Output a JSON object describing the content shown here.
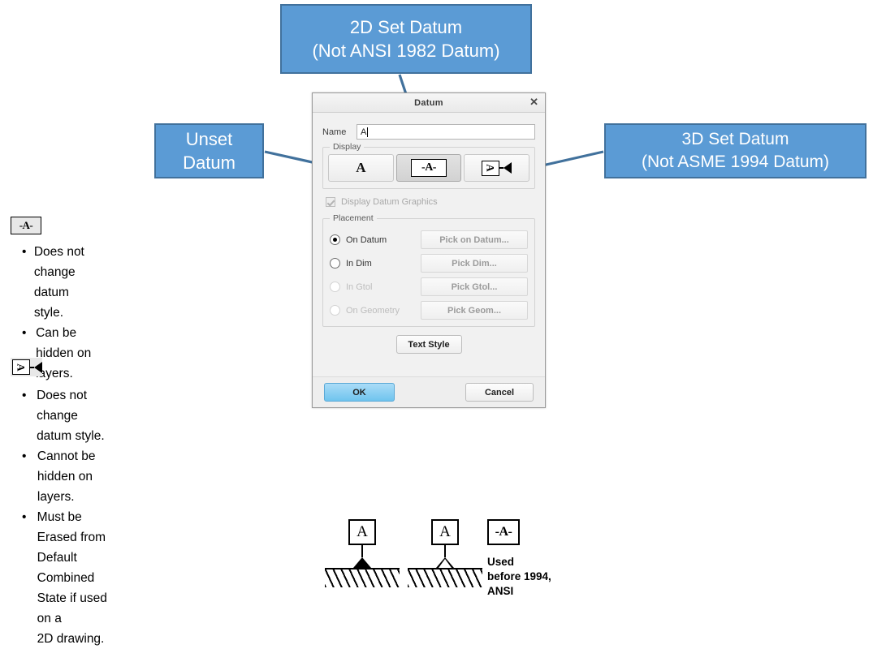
{
  "callouts": {
    "two_d": {
      "line1": "2D Set Datum",
      "line2": "(Not ANSI 1982 Datum)"
    },
    "unset": {
      "line1": "Unset",
      "line2": "Datum"
    },
    "three_d": {
      "line1": "3D Set Datum",
      "line2": "(Not ASME 1994 Datum)"
    }
  },
  "colors": {
    "callout_fill": "#5B9BD5",
    "callout_border": "#41719C",
    "arrow": "#41719C",
    "ok_button": "#6FC4EE"
  },
  "dialog": {
    "title": "Datum",
    "close_label": "✕",
    "name": {
      "label": "Name",
      "value": "A",
      "placeholder": ""
    },
    "display": {
      "legend": "Display",
      "buttons": [
        {
          "id": "unset-datum",
          "glyph": "A",
          "glyph_kind": "plain-A",
          "selected": false
        },
        {
          "id": "set-2d-datum",
          "glyph": "-A-",
          "glyph_kind": "boxed-dash-A",
          "selected": true
        },
        {
          "id": "set-3d-datum",
          "glyph": "A",
          "glyph_kind": "boxed-rotated-A-arrow",
          "selected": false
        }
      ]
    },
    "datum_graphics": {
      "label": "Display Datum Graphics",
      "checked": true,
      "enabled": false
    },
    "placement": {
      "legend": "Placement",
      "rows": [
        {
          "label": "On Datum",
          "selected": true,
          "enabled": true,
          "button": "Pick on Datum..."
        },
        {
          "label": "In Dim",
          "selected": false,
          "enabled": true,
          "button": "Pick Dim..."
        },
        {
          "label": "In Gtol",
          "selected": false,
          "enabled": false,
          "button": "Pick Gtol..."
        },
        {
          "label": "On Geometry",
          "selected": false,
          "enabled": false,
          "button": "Pick Geom..."
        }
      ]
    },
    "text_style_button": "Text Style",
    "ok_button": "OK",
    "cancel_button": "Cancel"
  },
  "notes": [
    {
      "icon": "-A-",
      "icon_kind": "boxed-dash-A",
      "bullets": [
        "Does not change datum style.",
        "Can be hidden on layers."
      ]
    },
    {
      "icon": "A",
      "icon_kind": "boxed-rotated-A-arrow",
      "bullets": [
        "Does not change datum style.",
        "Cannot be hidden on layers.",
        "Must be Erased from Default\nCombined State if used on a\n2D drawing."
      ]
    }
  ],
  "bullet_marker": "•",
  "symbols": [
    {
      "id": "filled-triangle-datum",
      "letter": "A",
      "triangle": "filled",
      "caption": ""
    },
    {
      "id": "open-triangle-datum",
      "letter": "A",
      "triangle": "open",
      "caption": ""
    },
    {
      "id": "pre1994-ansi-datum",
      "letter": "-A-",
      "triangle": "none",
      "caption": "Used\nbefore 1994,\nANSI"
    }
  ]
}
